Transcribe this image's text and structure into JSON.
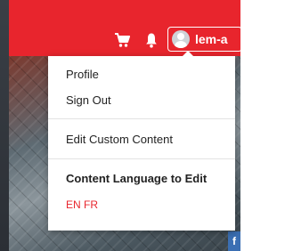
{
  "header": {
    "icons": {
      "cart": "shopping-cart-icon",
      "notifications": "bell-icon",
      "avatar": "user-avatar"
    },
    "user": {
      "name": "lem-a"
    },
    "brand_color": "#e8252d"
  },
  "dropdown": {
    "profile_label": "Profile",
    "sign_out_label": "Sign Out",
    "edit_custom_content_label": "Edit Custom Content",
    "language_heading": "Content Language to Edit",
    "languages": [
      "EN",
      "FR"
    ]
  },
  "hero": {
    "badge_text": "f"
  }
}
